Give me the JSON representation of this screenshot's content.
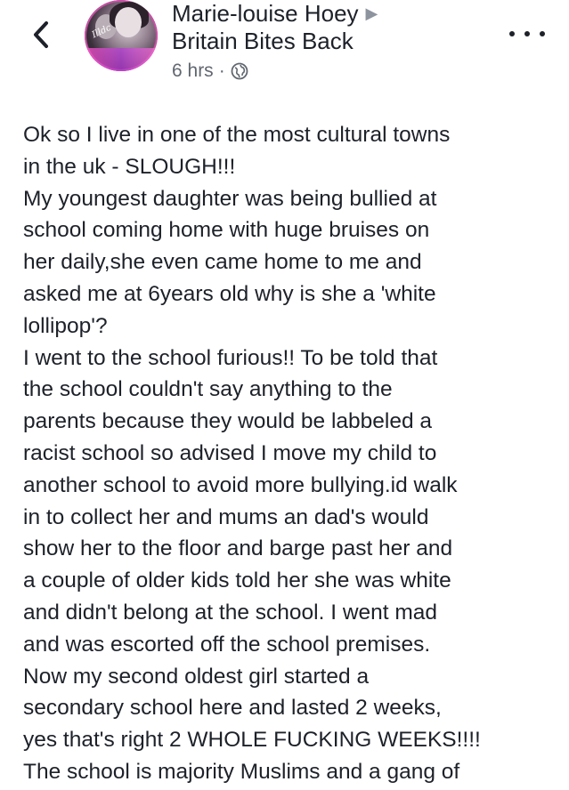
{
  "post": {
    "author": "Marie-louise Hoey",
    "group": "Britain Bites Back",
    "time": "6 hrs",
    "separator": "·",
    "privacy_icon": "globe-icon",
    "avatar_text": "Illdc",
    "lines": [
      "Ok so I live in one of the most cultural towns",
      "in the uk - SLOUGH!!!",
      "My youngest daughter was being bullied at",
      "school coming home with huge bruises on",
      "her daily,she even came home to me and",
      "asked me at 6years old why is she a 'white",
      "lollipop'?",
      "I went to the school furious!! To be told that",
      "the school couldn't say anything to the",
      "parents because they would be labbeled a",
      "racist school so advised I move my child to",
      "another school to avoid more bullying.id walk",
      "in to collect her and mums an dad's would",
      "show her to the floor and barge past her and",
      "a couple of older kids told her she was white",
      "and didn't belong at the school. I went mad",
      "and was escorted off the school premises.",
      "Now my second oldest girl started a",
      "secondary school here and lasted 2 weeks,",
      "yes that's right 2 WHOLE FUCKING WEEKS!!!!",
      "The school is majority Muslims and a gang of"
    ]
  },
  "colors": {
    "text": "#1d2129",
    "meta": "#616770",
    "arrow": "#8d949e"
  }
}
